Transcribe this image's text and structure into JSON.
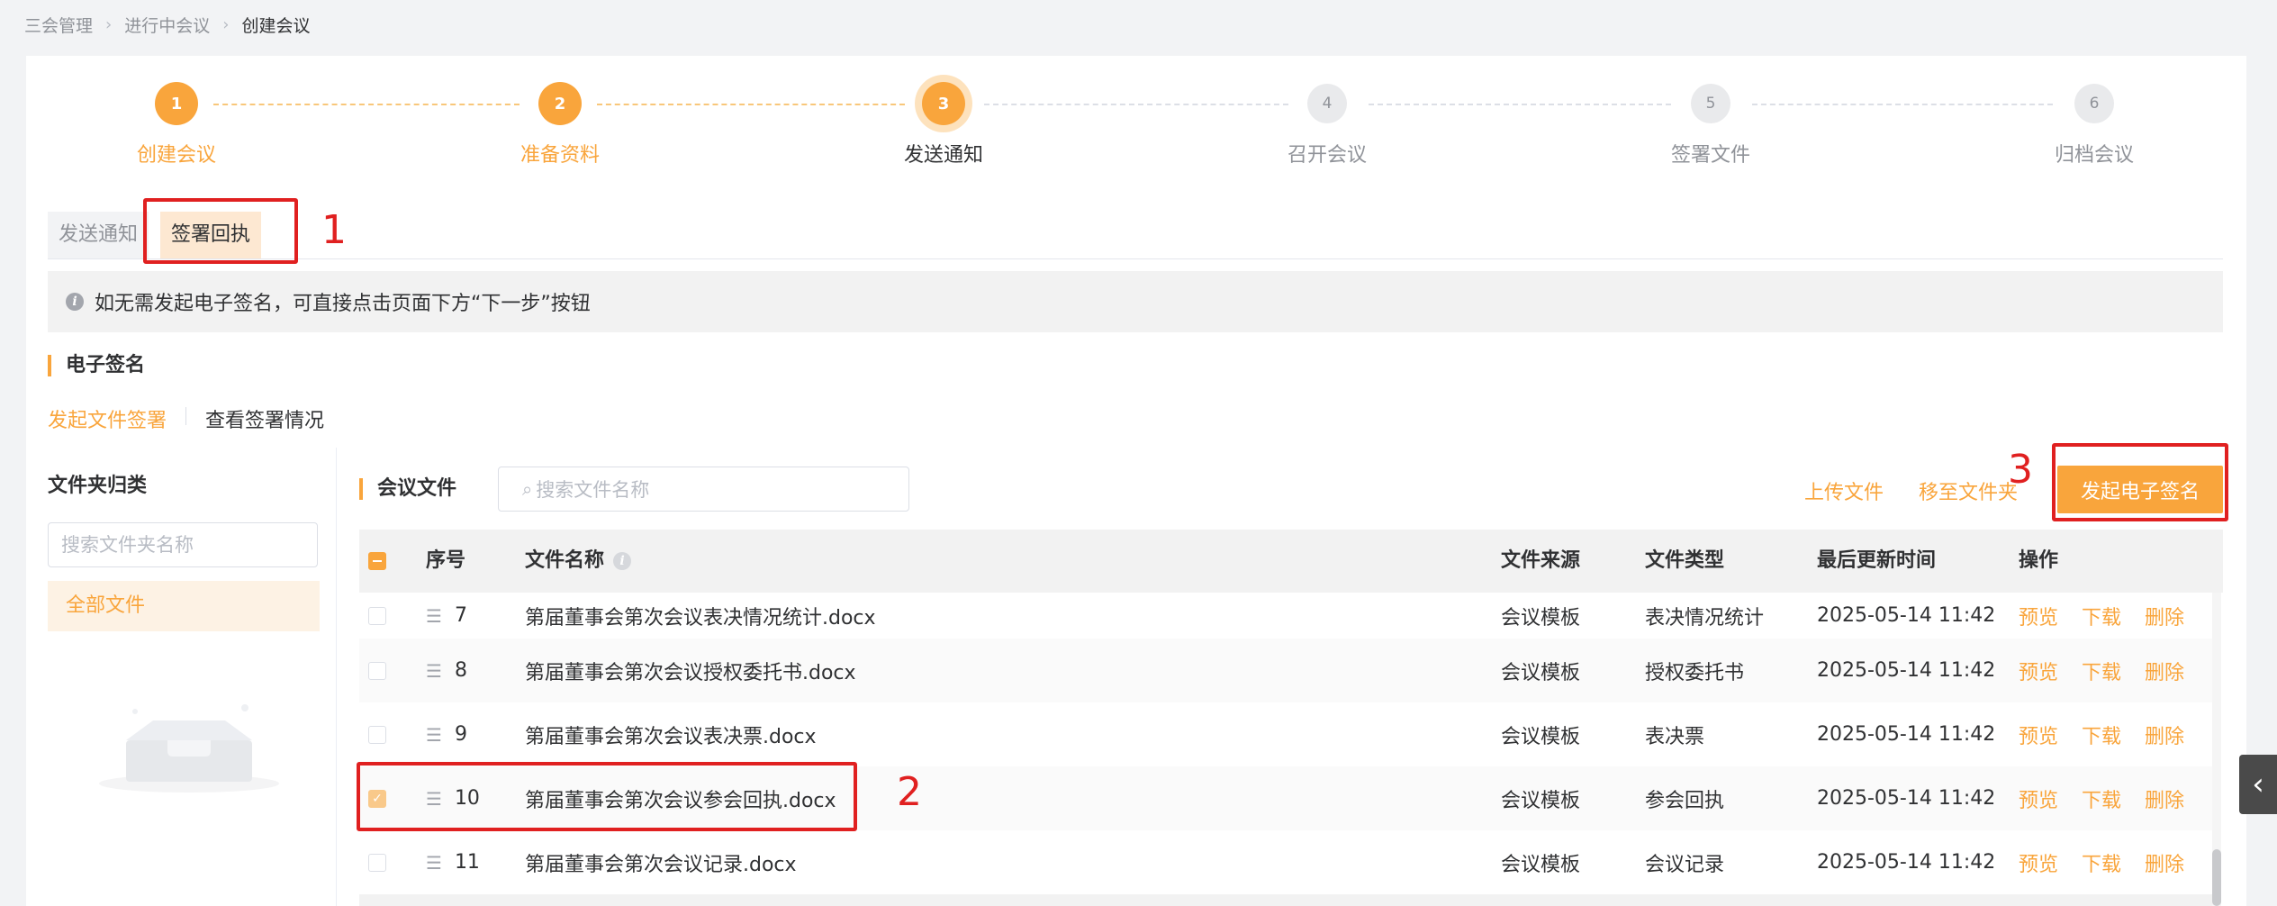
{
  "breadcrumb": [
    "三会管理",
    "进行中会议",
    "创建会议"
  ],
  "steps": [
    {
      "num": "1",
      "label": "创建会议",
      "state": "done"
    },
    {
      "num": "2",
      "label": "准备资料",
      "state": "done"
    },
    {
      "num": "3",
      "label": "发送通知",
      "state": "active"
    },
    {
      "num": "4",
      "label": "召开会议",
      "state": "todo"
    },
    {
      "num": "5",
      "label": "签署文件",
      "state": "todo"
    },
    {
      "num": "6",
      "label": "归档会议",
      "state": "todo"
    }
  ],
  "subtabs": [
    {
      "label": "发送通知",
      "active": false
    },
    {
      "label": "签署回执",
      "active": true
    }
  ],
  "info_text": "如无需发起电子签名，可直接点击页面下方“下一步”按钮",
  "esign_title": "电子签名",
  "esign_actions": {
    "start": "发起文件签署",
    "view": "查看签署情况"
  },
  "folder_panel": {
    "title": "文件夹归类",
    "search_placeholder": "搜索文件夹名称",
    "all_files": "全部文件"
  },
  "files_panel": {
    "title": "会议文件",
    "search_placeholder": "搜索文件名称",
    "upload": "上传文件",
    "move": "移至文件夹",
    "esign_button": "发起电子签名"
  },
  "table": {
    "headers": {
      "no": "序号",
      "name": "文件名称",
      "source": "文件来源",
      "type": "文件类型",
      "updated": "最后更新时间",
      "ops": "操作"
    },
    "ops": [
      "预览",
      "下载",
      "删除"
    ],
    "rows": [
      {
        "no": "7",
        "name": "第届董事会第次会议表决情况统计.docx",
        "source": "会议模板",
        "type": "表决情况统计",
        "updated": "2025-05-14 11:42",
        "checked": false
      },
      {
        "no": "8",
        "name": "第届董事会第次会议授权委托书.docx",
        "source": "会议模板",
        "type": "授权委托书",
        "updated": "2025-05-14 11:42",
        "checked": false
      },
      {
        "no": "9",
        "name": "第届董事会第次会议表决票.docx",
        "source": "会议模板",
        "type": "表决票",
        "updated": "2025-05-14 11:42",
        "checked": false
      },
      {
        "no": "10",
        "name": "第届董事会第次会议参会回执.docx",
        "source": "会议模板",
        "type": "参会回执",
        "updated": "2025-05-14 11:42",
        "checked": true
      },
      {
        "no": "11",
        "name": "第届董事会第次会议记录.docx",
        "source": "会议模板",
        "type": "会议记录",
        "updated": "2025-05-14 11:42",
        "checked": false
      }
    ]
  },
  "annotations": [
    "1",
    "2",
    "3"
  ],
  "colors": {
    "accent": "#f9a53c",
    "annotation": "#e02020"
  }
}
